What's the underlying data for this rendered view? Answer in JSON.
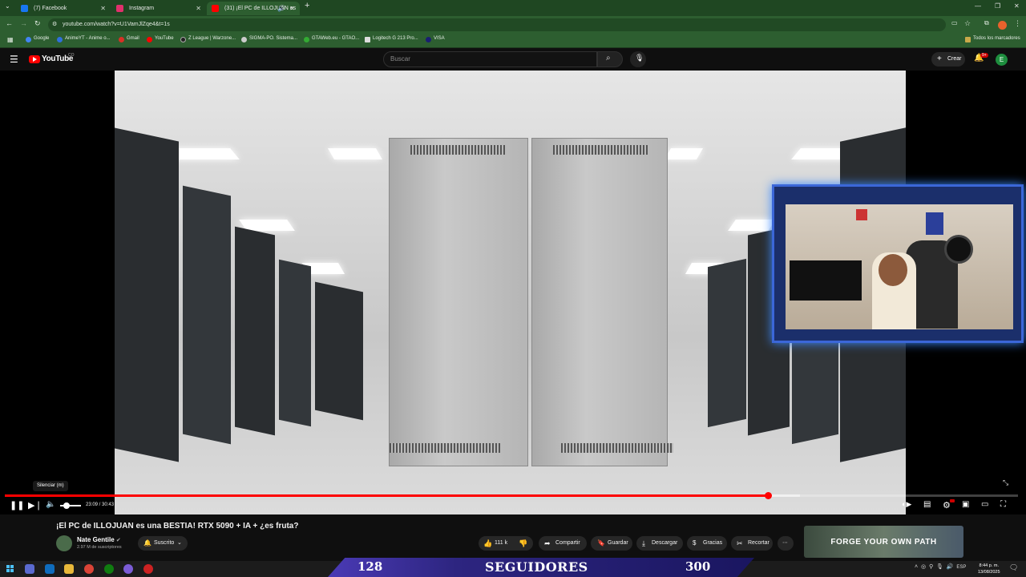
{
  "browser": {
    "tabs": [
      {
        "label": "(7) Facebook",
        "color": "#1877f2"
      },
      {
        "label": "Instagram",
        "color": "#e1306c"
      },
      {
        "label": "(31) ¡El PC de ILLOJUAN es",
        "color": "#ff0000"
      }
    ],
    "url": "youtube.com/watch?v=U1VamJlZqe4&t=1s",
    "bookmarks": [
      {
        "label": "Google",
        "color": "#4285f4"
      },
      {
        "label": "AnimeYT - Anime o...",
        "color": "#2f6fdd"
      },
      {
        "label": "Gmail",
        "color": "#d93025"
      },
      {
        "label": "YouTube",
        "color": "#ff0000"
      },
      {
        "label": "Z League | Warzone...",
        "color": "#222222"
      },
      {
        "label": "SIGMA-PO. Sistema...",
        "color": "#cccccc"
      },
      {
        "label": "GTAWeb.eu - GTAO...",
        "color": "#33aa33"
      },
      {
        "label": "Logitech G 213 Pro...",
        "color": "#dddddd"
      },
      {
        "label": "VISA",
        "color": "#1a1f71"
      }
    ],
    "all_bookmarks": "Todos los marcadores"
  },
  "youtube": {
    "logo": "YouTube",
    "country": "CO",
    "search_placeholder": "Buscar",
    "create_label": "Crear",
    "notif_count": "9+",
    "avatar_letter": "E"
  },
  "player": {
    "tooltip": "Silenciar (m)",
    "current_time": "23:09",
    "duration": "30:43",
    "progress_fraction": 0.753,
    "buffer_fraction": 0.785
  },
  "video": {
    "title": "¡El PC de ILLOJUAN es una BESTIA! RTX 5090 + IA + ¿es fruta?",
    "channel": "Nate Gentile",
    "subscribers": "2.97 M de suscriptores",
    "subscribe_label": "Suscrito",
    "likes": "111 k",
    "share_label": "Compartir",
    "save_label": "Guardar",
    "download_label": "Descargar",
    "thanks_label": "Gracias",
    "clip_label": "Recortar"
  },
  "ad": {
    "text": "FORGE YOUR OWN PATH"
  },
  "overlay": {
    "count": "128",
    "label": "SEGUIDORES",
    "goal": "300"
  },
  "taskbar": {
    "lang": "ESP",
    "time": "8:44 p. m.",
    "date": "13/08/2025"
  }
}
